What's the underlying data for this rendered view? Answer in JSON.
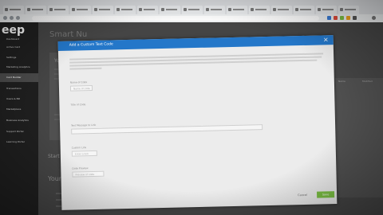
{
  "sidebar": {
    "logo": "eep",
    "items": [
      {
        "label": "Dashboard"
      },
      {
        "label": "Active Card"
      },
      {
        "label": "Settings"
      },
      {
        "label": "Marketing Analytics"
      },
      {
        "label": "Card Builder"
      },
      {
        "label": "Transactions"
      },
      {
        "label": "Users & Bill"
      },
      {
        "label": "Marketplace"
      },
      {
        "label": "Business Analytics"
      },
      {
        "label": "Support Portal"
      },
      {
        "label": "Learning Portal"
      }
    ]
  },
  "background": {
    "title": "Smart Nu",
    "card_heading": "Your",
    "section_heading": "Start your",
    "section_heading_2": "Your pers",
    "right_col_1": "Name",
    "right_col_2": "Modified"
  },
  "modal": {
    "title": "Add a Custom Text Code",
    "close_symbol": "×",
    "cancel_label": "Cancel",
    "save_label": "Save",
    "fields": [
      {
        "label": "Name of Code",
        "placeholder": "Name of code"
      },
      {
        "label": "Title of Code",
        "placeholder": ""
      },
      {
        "label": "Text Message to Link",
        "placeholder": ""
      },
      {
        "label": "Custom Link",
        "placeholder": "Enter a link"
      },
      {
        "label": "Code Preview",
        "placeholder": "Preview of code"
      }
    ]
  }
}
